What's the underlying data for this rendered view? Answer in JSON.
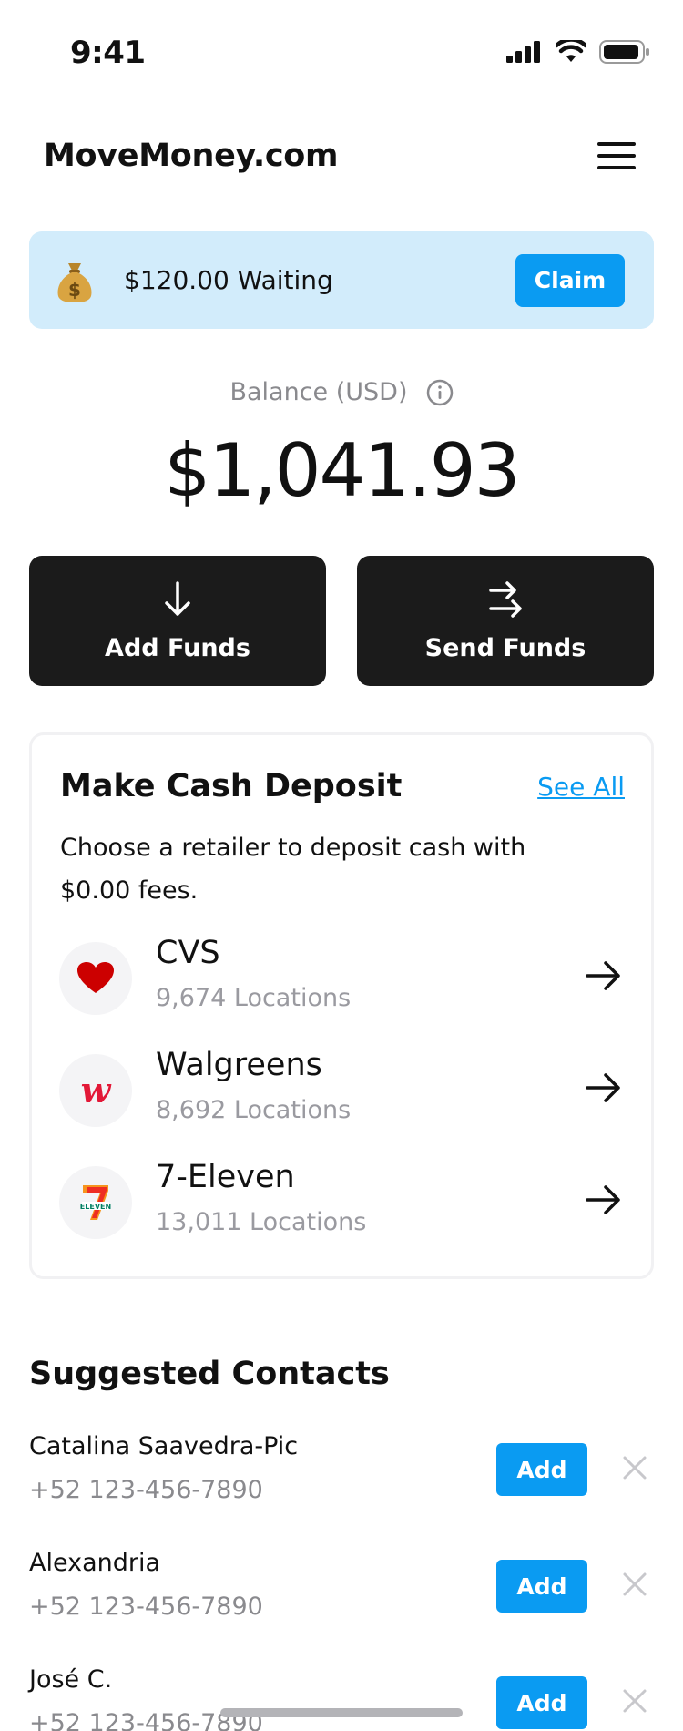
{
  "status_bar": {
    "time": "9:41",
    "signal_icon": "cellular-signal-icon",
    "wifi_icon": "wifi-icon",
    "battery_icon": "battery-icon"
  },
  "header": {
    "title": "MoveMoney.com",
    "menu_icon": "hamburger-menu-icon"
  },
  "waiting_banner": {
    "icon": "money-bag-icon",
    "text": "$120.00 Waiting",
    "claim_label": "Claim",
    "background": "#d2ecfb",
    "accent": "#0a9bf2"
  },
  "balance": {
    "label": "Balance (USD)",
    "info_icon": "info-icon",
    "amount": "$1,041.93"
  },
  "actions": [
    {
      "label": "Add Funds",
      "icon": "arrow-down-icon"
    },
    {
      "label": "Send Funds",
      "icon": "transfer-arrows-icon"
    }
  ],
  "deposit": {
    "title": "Make Cash Deposit",
    "see_all": "See All",
    "description": "Choose a retailer to deposit cash with $0.00 fees.",
    "retailers": [
      {
        "name": "CVS",
        "locations": "9,674 Locations",
        "logo": "cvs-heart-logo",
        "arrow_icon": "arrow-right-icon"
      },
      {
        "name": "Walgreens",
        "locations": "8,692 Locations",
        "logo": "walgreens-w-logo",
        "arrow_icon": "arrow-right-icon"
      },
      {
        "name": "7-Eleven",
        "locations": "13,011 Locations",
        "logo": "seven-eleven-logo",
        "arrow_icon": "arrow-right-icon"
      }
    ]
  },
  "contacts": {
    "title": "Suggested Contacts",
    "add_label": "Add",
    "dismiss_icon": "close-icon",
    "items": [
      {
        "name": "Catalina Saavedra-Pic",
        "phone": "+52 123-456-7890"
      },
      {
        "name": "Alexandria",
        "phone": "+52 123-456-7890"
      },
      {
        "name": "José C.",
        "phone": "+52 123-456-7890"
      }
    ]
  },
  "colors": {
    "primary_blue": "#0a9bf2",
    "dark_button": "#1b1b1b",
    "muted_text": "#8a8a8e"
  }
}
